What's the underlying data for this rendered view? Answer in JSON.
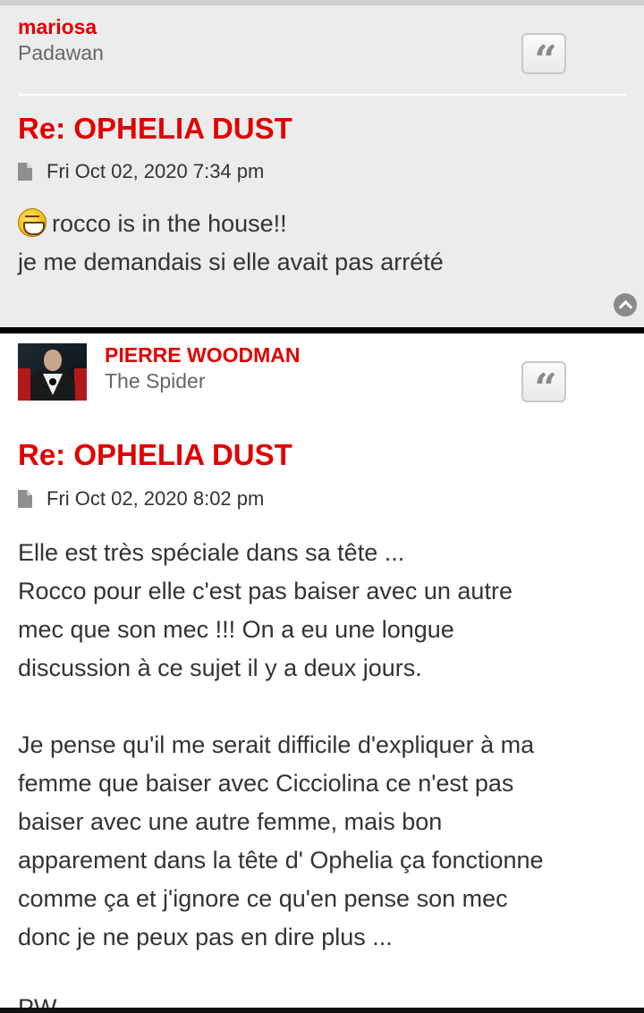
{
  "posts": [
    {
      "author": "mariosa",
      "rank": "Padawan",
      "title": "Re: OPHELIA DUST",
      "date": "Fri Oct 02, 2020 7:34 pm",
      "lines": [
        "rocco is in the house!!",
        "je me demandais si elle avait pas arrété"
      ],
      "emoji": "laughing-smiley-icon"
    },
    {
      "author": "PIERRE WOODMAN",
      "rank": "The Spider",
      "title": "Re: OPHELIA DUST",
      "date": "Fri Oct 02, 2020 8:02 pm",
      "lines": [
        "Elle est très spéciale dans sa tête ...",
        "Rocco pour elle c'est pas baiser avec un autre",
        "mec que son mec !!! On a eu une longue",
        "discussion à ce sujet il y a deux jours.",
        "",
        "Je pense qu'il me serait difficile d'expliquer à ma",
        "femme que baiser avec Cicciolina ce n'est pas",
        "baiser avec une autre femme, mais bon",
        "apparement dans la tête d' Ophelia ça fonctionne",
        "comme ça et j'ignore ce qu'en pense son mec",
        "donc je ne peux pas en dire plus ..."
      ],
      "signature_partial": "PW"
    }
  ],
  "icons": {
    "quote": "quote-icon",
    "post": "file-icon",
    "back_to_top": "chevron-up-icon"
  },
  "colors": {
    "accent": "#e10000",
    "post1_bg": "#ececec",
    "post2_bg": "#ffffff"
  }
}
